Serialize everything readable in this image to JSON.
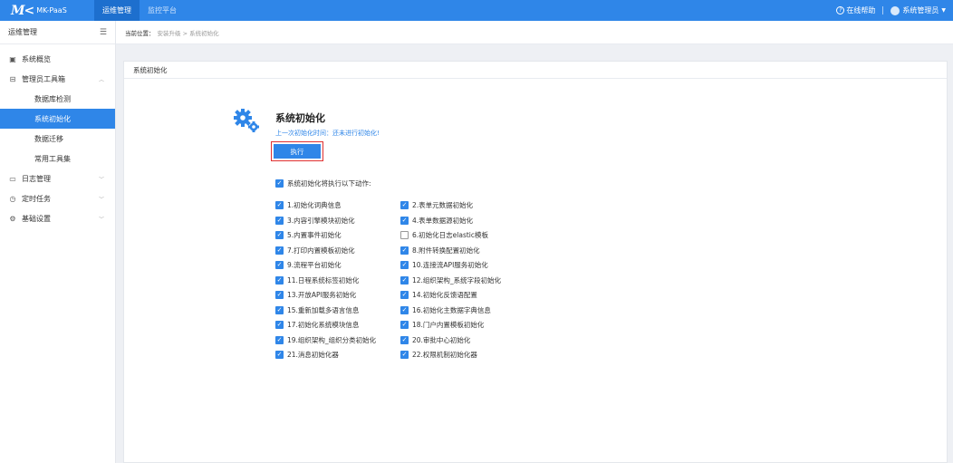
{
  "topbar": {
    "logo_mark": "M<",
    "logo_text": "MK-PaaS",
    "nav": [
      "运维管理",
      "监控平台"
    ],
    "help": "在线帮助",
    "user": "系统管理员"
  },
  "sidebar": {
    "title": "运维管理",
    "items": [
      {
        "label": "系统概览",
        "icon": "dashboard-icon"
      },
      {
        "label": "管理员工具箱",
        "icon": "toolbox-icon",
        "expanded": true
      },
      {
        "label": "日志管理",
        "icon": "monitor-icon"
      },
      {
        "label": "定时任务",
        "icon": "clock-icon"
      },
      {
        "label": "基础设置",
        "icon": "gear-icon"
      }
    ],
    "sub_items": [
      "数据库检测",
      "系统初始化",
      "数据迁移",
      "常用工具集"
    ],
    "active_sub": "系统初始化"
  },
  "breadcrumb": {
    "label": "当前位置：",
    "path": "安装升级 > 系统初始化"
  },
  "card": {
    "header": "系统初始化",
    "title": "系统初始化",
    "last_time": "上一次初始化时间：还未进行初始化!",
    "exec_button": "执行",
    "master_checkbox": "系统初始化将执行以下动作:"
  },
  "actions": [
    {
      "label": "1.初始化词典信息",
      "checked": true
    },
    {
      "label": "2.表单元数据初始化",
      "checked": true
    },
    {
      "label": "3.内容引擎模块初始化",
      "checked": true
    },
    {
      "label": "4.表单数据源初始化",
      "checked": true
    },
    {
      "label": "5.内置事件初始化",
      "checked": true
    },
    {
      "label": "6.初始化日志elastic模板",
      "checked": false
    },
    {
      "label": "7.打印内置模板初始化",
      "checked": true
    },
    {
      "label": "8.附件转换配置初始化",
      "checked": true
    },
    {
      "label": "9.流程平台初始化",
      "checked": true
    },
    {
      "label": "10.连接流API服务初始化",
      "checked": true
    },
    {
      "label": "11.日程系统标签初始化",
      "checked": true
    },
    {
      "label": "12.组织架构_系统字段初始化",
      "checked": true
    },
    {
      "label": "13.开放API服务初始化",
      "checked": true
    },
    {
      "label": "14.初始化反馈语配置",
      "checked": true
    },
    {
      "label": "15.重新加载多语言信息",
      "checked": true
    },
    {
      "label": "16.初始化主数据字典信息",
      "checked": true
    },
    {
      "label": "17.初始化系统模块信息",
      "checked": true
    },
    {
      "label": "18.门户内置模板初始化",
      "checked": true
    },
    {
      "label": "19.组织架构_组织分类初始化",
      "checked": true
    },
    {
      "label": "20.审批中心初始化",
      "checked": true
    },
    {
      "label": "21.消息初始化器",
      "checked": true
    },
    {
      "label": "22.权限机制初始化器",
      "checked": true
    }
  ],
  "colors": {
    "primary": "#2f86e8",
    "topbar": "#2f86e8",
    "highlight_border": "#e03030"
  }
}
